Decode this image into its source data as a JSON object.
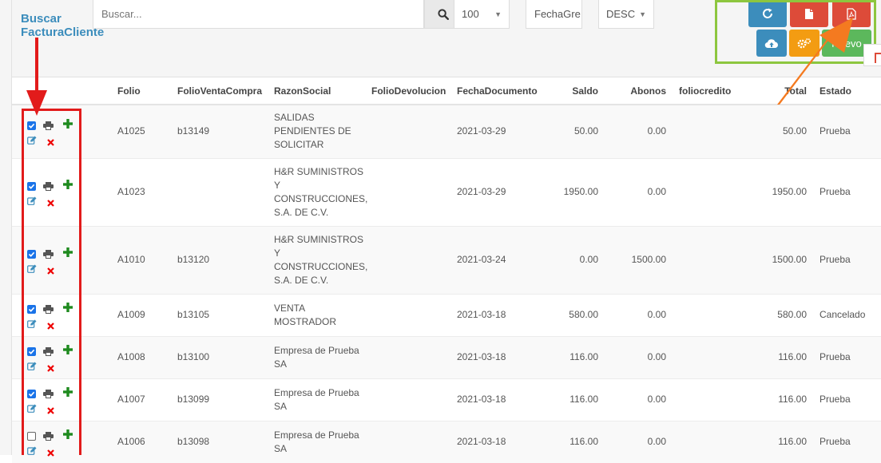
{
  "header": {
    "title_line1": "Buscar",
    "title_line2": "FacturaCliente",
    "search_placeholder": "Buscar...",
    "page_size": "100",
    "sort_field": "FechaGre",
    "sort_order": "DESC",
    "new_button_label": "Nuevo"
  },
  "icons": {
    "search": "search-icon",
    "refresh": "refresh-icon",
    "document": "file-icon",
    "pdf": "file-pdf-icon",
    "cloud_upload": "cloud-upload-icon",
    "settings": "cogs-icon",
    "print": "print-icon",
    "add": "plus-icon",
    "edit": "edit-icon",
    "delete": "delete-icon"
  },
  "colors": {
    "accent_blue": "#3c8dbc",
    "danger_red": "#dd4b39",
    "warning_yellow": "#f39c12",
    "success_green": "#5cb85c",
    "highlight_green": "#8dc63f",
    "annotation_red": "#e21b1b",
    "annotation_orange": "#f47a20"
  },
  "table": {
    "columns": [
      "Folio",
      "FolioVentaCompra",
      "RazonSocial",
      "FolioDevolucion",
      "FechaDocumento",
      "Saldo",
      "Abonos",
      "foliocredito",
      "Total",
      "Estado"
    ],
    "rows": [
      {
        "checked": true,
        "folio": "A1025",
        "folio_venta_compra": "b13149",
        "razon_social": "SALIDAS PENDIENTES DE SOLICITAR",
        "folio_devolucion": "",
        "fecha_documento": "2021-03-29",
        "saldo": "50.00",
        "abonos": "0.00",
        "foliocredito": "",
        "total": "50.00",
        "estado": "Prueba"
      },
      {
        "checked": true,
        "folio": "A1023",
        "folio_venta_compra": "",
        "razon_social": "H&R SUMINISTROS Y CONSTRUCCIONES, S.A. DE C.V.",
        "folio_devolucion": "",
        "fecha_documento": "2021-03-29",
        "saldo": "1950.00",
        "abonos": "0.00",
        "foliocredito": "",
        "total": "1950.00",
        "estado": "Prueba"
      },
      {
        "checked": true,
        "folio": "A1010",
        "folio_venta_compra": "b13120",
        "razon_social": "H&R SUMINISTROS Y CONSTRUCCIONES, S.A. DE C.V.",
        "folio_devolucion": "",
        "fecha_documento": "2021-03-24",
        "saldo": "0.00",
        "abonos": "1500.00",
        "foliocredito": "",
        "total": "1500.00",
        "estado": "Prueba"
      },
      {
        "checked": true,
        "folio": "A1009",
        "folio_venta_compra": "b13105",
        "razon_social": "VENTA MOSTRADOR",
        "folio_devolucion": "",
        "fecha_documento": "2021-03-18",
        "saldo": "580.00",
        "abonos": "0.00",
        "foliocredito": "",
        "total": "580.00",
        "estado": "Cancelado"
      },
      {
        "checked": true,
        "folio": "A1008",
        "folio_venta_compra": "b13100",
        "razon_social": "Empresa de Prueba SA",
        "folio_devolucion": "",
        "fecha_documento": "2021-03-18",
        "saldo": "116.00",
        "abonos": "0.00",
        "foliocredito": "",
        "total": "116.00",
        "estado": "Prueba"
      },
      {
        "checked": true,
        "folio": "A1007",
        "folio_venta_compra": "b13099",
        "razon_social": "Empresa de Prueba SA",
        "folio_devolucion": "",
        "fecha_documento": "2021-03-18",
        "saldo": "116.00",
        "abonos": "0.00",
        "foliocredito": "",
        "total": "116.00",
        "estado": "Prueba"
      },
      {
        "checked": false,
        "folio": "A1006",
        "folio_venta_compra": "b13098",
        "razon_social": "Empresa de Prueba SA",
        "folio_devolucion": "",
        "fecha_documento": "2021-03-18",
        "saldo": "116.00",
        "abonos": "0.00",
        "foliocredito": "",
        "total": "116.00",
        "estado": "Prueba"
      }
    ]
  }
}
